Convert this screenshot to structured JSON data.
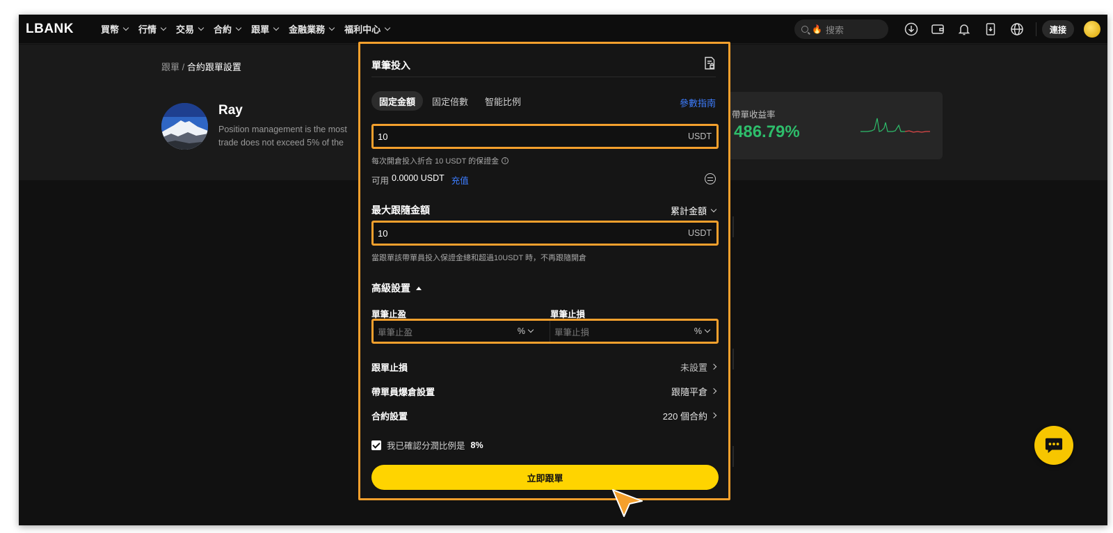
{
  "nav": {
    "logo": "LBANK",
    "items": [
      "買幣",
      "行情",
      "交易",
      "合約",
      "跟單",
      "金融業務",
      "福利中心"
    ],
    "search_placeholder": "搜索",
    "connect_label": "連接"
  },
  "page": {
    "breadcrumb_parent": "跟單",
    "breadcrumb_sep": "/",
    "breadcrumb_current": "合約跟單設置",
    "trader_name": "Ray",
    "trader_desc_line1": "Position management is the most",
    "trader_desc_line2": "trade does not exceed 5% of the",
    "stat_label": "帶單收益率",
    "stat_value": "486.79%"
  },
  "modal": {
    "title": "單筆投入",
    "tabs": [
      "固定金額",
      "固定倍數",
      "智能比例"
    ],
    "guide_link": "參數指南",
    "amount_value": "10",
    "amount_unit": "USDT",
    "amount_hint": "每次開倉投入折合 10 USDT 的保證金",
    "available_label": "可用",
    "available_amount": "0.0000 USDT",
    "deposit_link": "充值",
    "max_title": "最大跟隨金額",
    "max_mode": "累計金額",
    "max_value": "10",
    "max_unit": "USDT",
    "max_hint": "當跟單該帶單員投入保證金總和超過10USDT 時，不再跟隨開倉",
    "advanced_title": "高級設置",
    "tp_label": "單筆止盈",
    "sl_label": "單筆止損",
    "tp_placeholder": "單筆止盈",
    "sl_placeholder": "單筆止損",
    "pct": "%",
    "rows": [
      {
        "label": "跟單止損",
        "value": "未設置"
      },
      {
        "label": "帶單員爆倉設置",
        "value": "跟隨平倉"
      },
      {
        "label": "合約設置",
        "value": "220 個合約"
      }
    ],
    "confirm_text": "我已確認分潤比例是",
    "confirm_ratio": "8%",
    "submit_label": "立即跟單"
  },
  "colors": {
    "accent_outline": "#f4a02d",
    "cta": "#ffd400",
    "link": "#3d7dff",
    "profit": "#2ebd6b"
  }
}
